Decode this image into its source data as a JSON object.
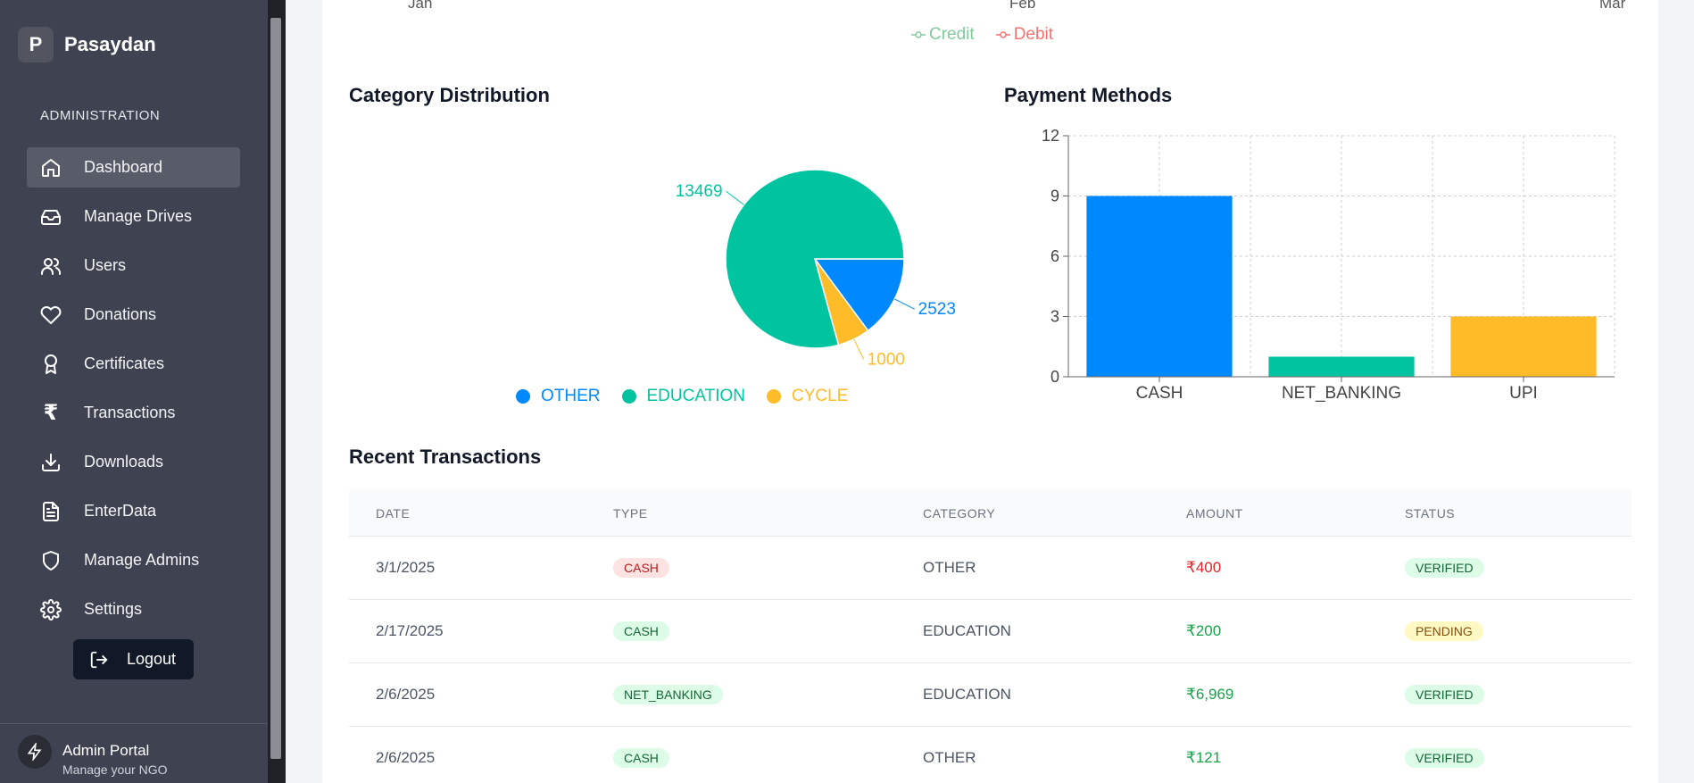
{
  "brand": {
    "logo_letter": "P",
    "name": "Pasaydan"
  },
  "sidebar": {
    "section_label": "ADMINISTRATION",
    "items": [
      {
        "label": "Dashboard",
        "icon": "home-icon",
        "active": true
      },
      {
        "label": "Manage Drives",
        "icon": "inbox-icon"
      },
      {
        "label": "Users",
        "icon": "users-icon"
      },
      {
        "label": "Donations",
        "icon": "heart-icon"
      },
      {
        "label": "Certificates",
        "icon": "award-icon"
      },
      {
        "label": "Transactions",
        "icon": "rupee-icon"
      },
      {
        "label": "Downloads",
        "icon": "download-icon"
      },
      {
        "label": "EnterData",
        "icon": "document-icon"
      },
      {
        "label": "Manage Admins",
        "icon": "shield-icon"
      },
      {
        "label": "Settings",
        "icon": "gear-icon"
      }
    ],
    "logout_label": "Logout",
    "footer": {
      "title": "Admin Portal",
      "subtitle": "Manage your NGO"
    }
  },
  "line_chart": {
    "x_ticks": [
      "Jan",
      "Feb",
      "Mar"
    ],
    "legend": [
      {
        "name": "Credit",
        "color": "#82ca9d"
      },
      {
        "name": "Debit",
        "color": "#f87171"
      }
    ]
  },
  "category_chart": {
    "title": "Category Distribution"
  },
  "payment_chart": {
    "title": "Payment Methods"
  },
  "chart_data": [
    {
      "type": "pie",
      "title": "Category Distribution",
      "slices": [
        {
          "name": "OTHER",
          "value": 2523,
          "color": "#0088fe"
        },
        {
          "name": "CYCLE",
          "value": 1000,
          "color": "#ffbb28"
        },
        {
          "name": "EDUCATION",
          "value": 13469,
          "color": "#00c49f"
        }
      ],
      "legend": [
        "OTHER",
        "EDUCATION",
        "CYCLE"
      ],
      "legend_placement": "bottom"
    },
    {
      "type": "bar",
      "title": "Payment Methods",
      "categories": [
        "CASH",
        "NET_BANKING",
        "UPI"
      ],
      "values": [
        9,
        1,
        3
      ],
      "colors": [
        "#0088fe",
        "#00c49f",
        "#ffbb28"
      ],
      "yticks": [
        0,
        3,
        6,
        9,
        12
      ],
      "ylim": [
        0,
        12
      ],
      "grid": true
    }
  ],
  "recent": {
    "title": "Recent Transactions",
    "headers": [
      "DATE",
      "TYPE",
      "CATEGORY",
      "AMOUNT",
      "STATUS"
    ],
    "rows": [
      {
        "date": "3/1/2025",
        "type": "CASH",
        "category": "OTHER",
        "amount": "₹400",
        "status": "VERIFIED"
      },
      {
        "date": "2/17/2025",
        "type": "CASH",
        "category": "EDUCATION",
        "amount": "₹200",
        "status": "PENDING"
      },
      {
        "date": "2/6/2025",
        "type": "NET_BANKING",
        "category": "EDUCATION",
        "amount": "₹6,969",
        "status": "VERIFIED"
      },
      {
        "date": "2/6/2025",
        "type": "CASH",
        "category": "OTHER",
        "amount": "₹121",
        "status": "VERIFIED"
      }
    ]
  }
}
